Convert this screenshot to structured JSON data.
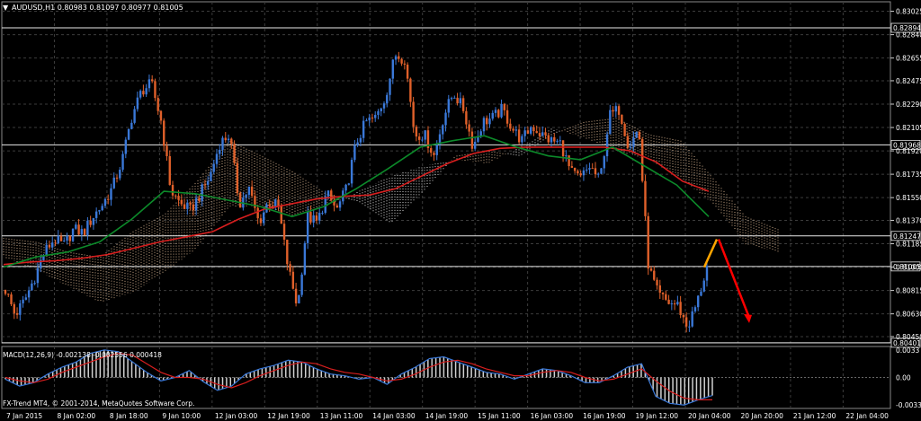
{
  "symbol_header": {
    "label": "AUDUSD,H1  0.80983 0.81097 0.80977 0.81005",
    "arrow": "▼"
  },
  "macd_header": {
    "label": "MACD(12,26,9) -0.002138 -0.002556 0.000418"
  },
  "copyright": "FX-Trend MT4, © 2001-2014, MetaQuotes Software Corp.",
  "colors": {
    "background": "#000000",
    "grid": "#3c3c3c",
    "bull_candle": "#3a78d8",
    "bear_candle": "#e0602a",
    "ma_slow": "#d81e1e",
    "ma_fast": "#0c8a2a",
    "cloud_bull": "#f0c8a0",
    "cloud_bear": "#ffffff",
    "macd_hist": "#d0d0d0",
    "macd_line": "#3a78d8",
    "signal_line": "#d81e1e",
    "forecast_up": "#ffa500",
    "forecast_down": "#ff0000"
  },
  "chart_data": [
    {
      "type": "candlestick",
      "title": "AUDUSD,H1",
      "ohlc_last": {
        "open": 0.80983,
        "high": 0.81097,
        "low": 0.80977,
        "close": 0.81005
      },
      "y_ticks": [
        "0.83025",
        "0.82840",
        "0.82655",
        "0.82475",
        "0.82290",
        "0.82105",
        "0.81920",
        "0.81735",
        "0.81550",
        "0.81370",
        "0.81185",
        "0.81000",
        "0.80815",
        "0.80630",
        "0.80450"
      ],
      "ylim": [
        0.804,
        0.831
      ],
      "x_ticks": [
        "7 Jan 2015",
        "8 Jan 02:00",
        "8 Jan 18:00",
        "9 Jan 10:00",
        "12 Jan 03:00",
        "12 Jan 19:00",
        "13 Jan 11:00",
        "14 Jan 03:00",
        "14 Jan 19:00",
        "15 Jan 11:00",
        "16 Jan 03:00",
        "16 Jan 19:00",
        "19 Jan 12:00",
        "20 Jan 04:00",
        "20 Jan 20:00",
        "21 Jan 12:00",
        "22 Jan 04:00"
      ],
      "horizontal_levels": [
        {
          "value": 0.82894,
          "label": "0.82894"
        },
        {
          "value": 0.81968,
          "label": "0.81968"
        },
        {
          "value": 0.81247,
          "label": "0.81247"
        },
        {
          "value": 0.81005,
          "label": "0.81005"
        },
        {
          "value": 0.80401,
          "label": "0.80401"
        }
      ],
      "close_path": [
        0.8082,
        0.8062,
        0.8074,
        0.8092,
        0.8112,
        0.8122,
        0.8117,
        0.813,
        0.8127,
        0.814,
        0.815,
        0.8163,
        0.8185,
        0.822,
        0.824,
        0.8245,
        0.8215,
        0.816,
        0.815,
        0.8145,
        0.8158,
        0.8172,
        0.8198,
        0.8205,
        0.815,
        0.8162,
        0.8135,
        0.8152,
        0.8148,
        0.81,
        0.8068,
        0.814,
        0.8135,
        0.8158,
        0.8145,
        0.8162,
        0.8198,
        0.8215,
        0.8218,
        0.8235,
        0.8268,
        0.8265,
        0.8205,
        0.8205,
        0.8188,
        0.822,
        0.8238,
        0.8225,
        0.8195,
        0.8215,
        0.8218,
        0.8225,
        0.821,
        0.82,
        0.8212,
        0.8205,
        0.82,
        0.8198,
        0.8175,
        0.817,
        0.818,
        0.8168,
        0.822,
        0.8225,
        0.8195,
        0.821,
        0.81,
        0.8078,
        0.8072,
        0.807,
        0.8052,
        0.8072,
        0.81
      ],
      "ma_slow": [
        0.8102,
        0.8104,
        0.8105,
        0.8107,
        0.811,
        0.8115,
        0.812,
        0.8124,
        0.8128,
        0.8138,
        0.8146,
        0.815,
        0.8154,
        0.8156,
        0.8157,
        0.8162,
        0.8172,
        0.8182,
        0.819,
        0.8194,
        0.8195,
        0.8195,
        0.8195,
        0.8195,
        0.8192,
        0.8183,
        0.8168,
        0.816
      ],
      "ma_fast": [
        0.81,
        0.8108,
        0.8112,
        0.812,
        0.8138,
        0.816,
        0.8158,
        0.8153,
        0.8148,
        0.814,
        0.8148,
        0.8162,
        0.8178,
        0.8195,
        0.82,
        0.8204,
        0.8195,
        0.8188,
        0.8185,
        0.8195,
        0.818,
        0.8165,
        0.814
      ],
      "ichimoku_cloud_a": [
        0.8123,
        0.812,
        0.8112,
        0.8108,
        0.8128,
        0.8142,
        0.8168,
        0.82,
        0.8188,
        0.8175,
        0.8158,
        0.8152,
        0.8135,
        0.816,
        0.8188,
        0.8192,
        0.8188,
        0.8205,
        0.8215,
        0.8218,
        0.8205,
        0.82,
        0.817,
        0.814,
        0.813
      ],
      "ichimoku_cloud_b": [
        0.8108,
        0.8098,
        0.8085,
        0.8072,
        0.808,
        0.8096,
        0.8115,
        0.8148,
        0.8148,
        0.814,
        0.8148,
        0.816,
        0.8172,
        0.818,
        0.8185,
        0.8182,
        0.8195,
        0.821,
        0.8202,
        0.8192,
        0.8185,
        0.817,
        0.815,
        0.8118,
        0.8112
      ],
      "forecast": {
        "up_to": 0.8122,
        "down_to": 0.806
      }
    },
    {
      "type": "bar+line",
      "title": "MACD(12,26,9)",
      "y_ticks": [
        "0.0033",
        "0.00",
        "-0.00333"
      ],
      "ylim": [
        -0.0036,
        0.0036
      ],
      "macd_main": [
        -0.0002,
        -0.001,
        -0.0006,
        0.0004,
        0.0012,
        0.0018,
        0.0028,
        0.0032,
        0.003,
        0.0018,
        0.0006,
        -0.0004,
        0.0,
        0.0008,
        -0.0005,
        -0.0015,
        -0.001,
        0.0004,
        0.001,
        0.0014,
        0.002,
        0.0018,
        0.001,
        0.0004,
        0.0002,
        -0.0002,
        0.0,
        -0.0008,
        0.0004,
        0.0012,
        0.0022,
        0.0024,
        0.0018,
        0.0012,
        0.0006,
        0.0004,
        -0.0002,
        0.0004,
        0.001,
        0.0008,
        0.0002,
        -0.0006,
        -0.0006,
        0.0002,
        0.0012,
        0.0016,
        -0.0022,
        -0.003,
        -0.0032,
        -0.0026,
        -0.0021
      ],
      "macd_signal": [
        0.0,
        -0.0004,
        -0.0006,
        -0.0002,
        0.0006,
        0.0012,
        0.0018,
        0.0024,
        0.0028,
        0.0026,
        0.0016,
        0.0006,
        0.0,
        0.0,
        -0.0002,
        -0.0008,
        -0.0012,
        -0.0006,
        0.0002,
        0.0008,
        0.0014,
        0.0018,
        0.0016,
        0.001,
        0.0006,
        0.0004,
        0.0,
        -0.0004,
        -0.0002,
        0.0004,
        0.0012,
        0.0018,
        0.002,
        0.0016,
        0.001,
        0.0006,
        0.0002,
        0.0002,
        0.0006,
        0.0008,
        0.0006,
        0.0,
        -0.0004,
        -0.0002,
        0.0004,
        0.001,
        -0.0004,
        -0.0016,
        -0.0024,
        -0.0026,
        -0.0026
      ]
    }
  ]
}
